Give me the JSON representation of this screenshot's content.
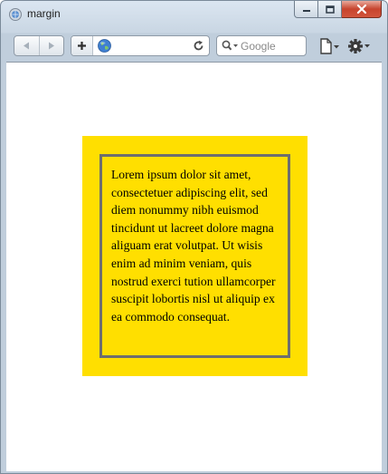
{
  "window": {
    "title": "margin",
    "controls": {
      "minimize": "minimize",
      "maximize": "maximize",
      "close": "close"
    }
  },
  "toolbar": {
    "back_icon": "back-arrow-icon",
    "forward_icon": "forward-arrow-icon",
    "add_icon": "plus-icon",
    "site_icon": "globe-icon",
    "reload_icon": "reload-icon",
    "search": {
      "placeholder": "Google",
      "value": ""
    },
    "page_menu_icon": "page-icon",
    "tools_menu_icon": "gear-icon"
  },
  "content": {
    "paragraph": "Lorem ipsum dolor sit amet, consectetuer adipiscing elit, sed diem nonummy nibh euismod tincidunt ut lacreet dolore magna aliguam erat volutpat. Ut wisis enim ad minim veniam, quis nostrud exerci tution ullamcorper suscipit lobortis nisl ut aliquip ex ea commodo consequat."
  },
  "colors": {
    "outer_box": "#ffdf00",
    "inner_border": "#6e6e6e",
    "close_button": "#c7442e"
  }
}
